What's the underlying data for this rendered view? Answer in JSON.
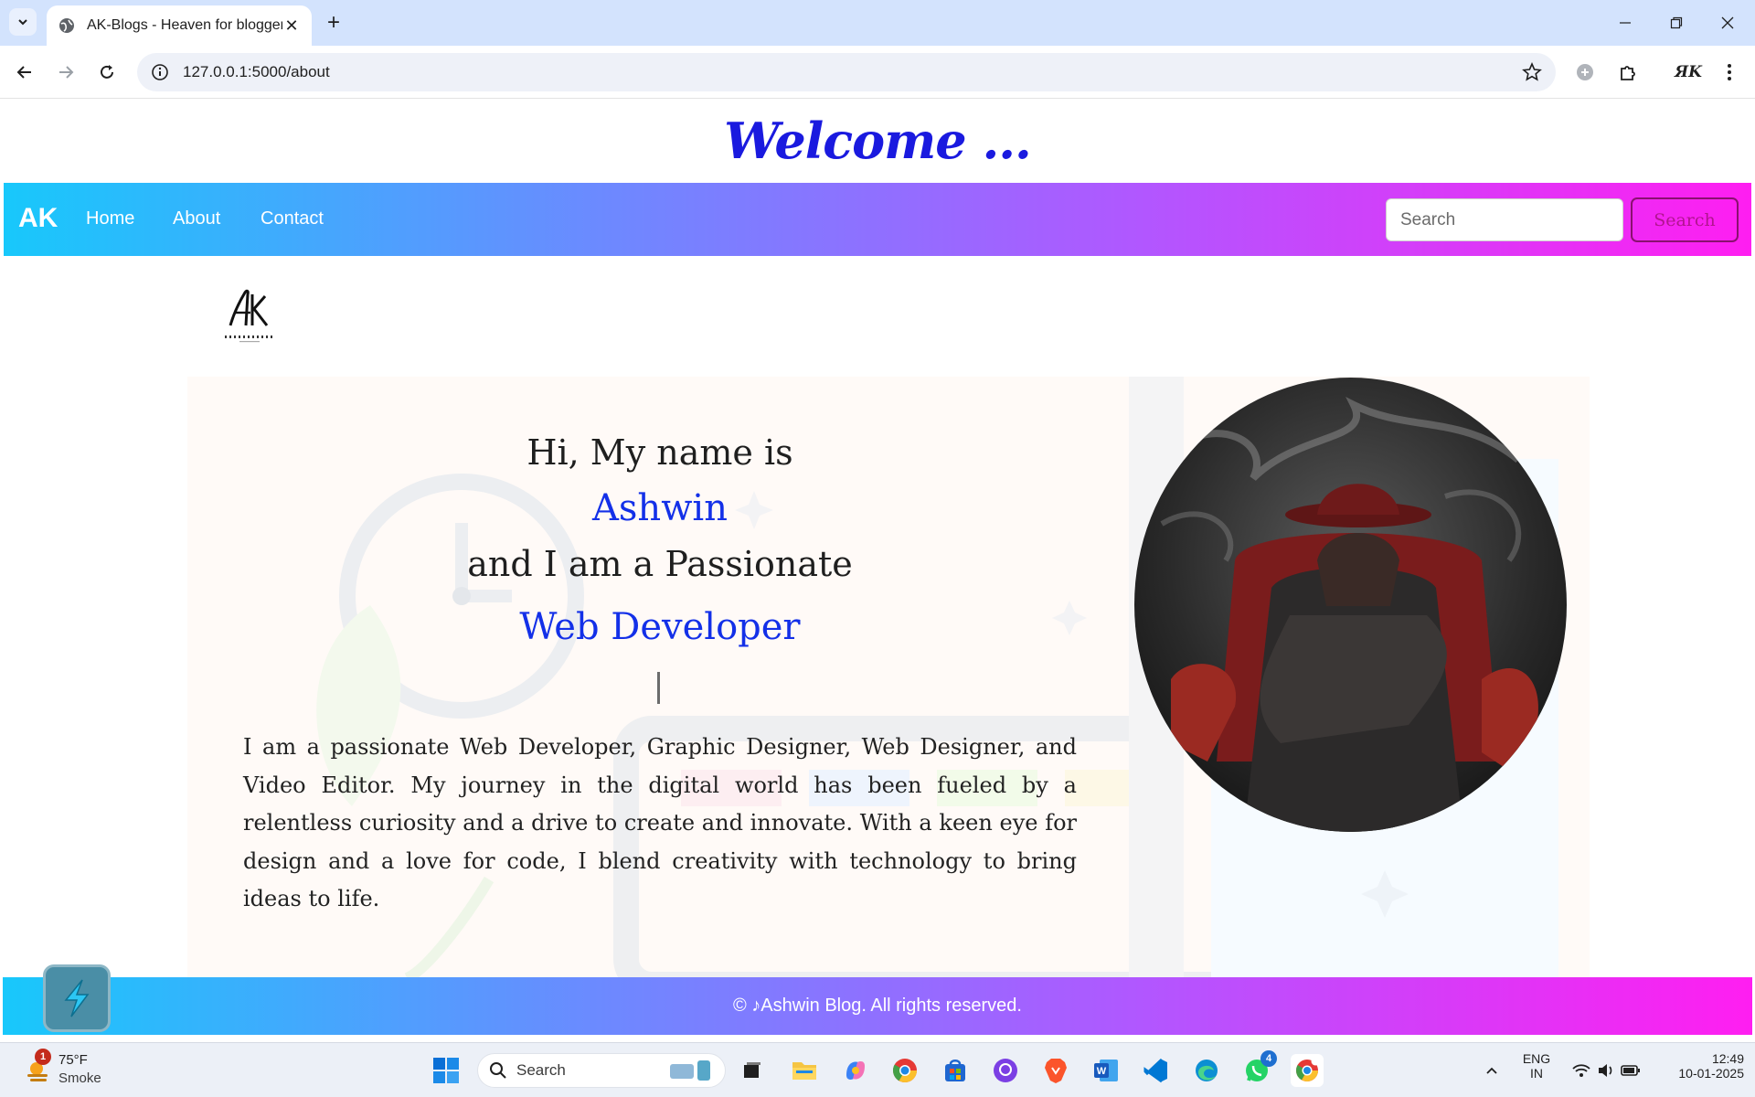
{
  "browser": {
    "tab_title": "AK-Blogs - Heaven for bloggers",
    "url": "127.0.0.1:5000/about"
  },
  "page": {
    "welcome": "Welcome ...",
    "nav": {
      "brand": "AK",
      "links": [
        "Home",
        "About",
        "Contact"
      ],
      "search_placeholder": "Search",
      "search_button": "Search"
    },
    "hero": {
      "intro_1": "Hi, My name is",
      "name": "Ashwin",
      "intro_2": "and I am a Passionate",
      "role": "Web Developer",
      "paragraph": "I am a passionate Web Developer, Graphic Designer, Web Designer, and Video Editor. My journey in the digital world has been fueled by a relentless curiosity and a drive to create and innovate. With a keen eye for design and a love for code, I blend creativity with technology to bring ideas to life."
    },
    "footer": "© ♪Ashwin Blog. All rights reserved."
  },
  "taskbar": {
    "weather_temp": "75°F",
    "weather_cond": "Smoke",
    "weather_badge": "1",
    "search_label": "Search",
    "whatsapp_badge": "4",
    "lang_1": "ENG",
    "lang_2": "IN",
    "time": "12:49",
    "date": "10-01-2025"
  },
  "colors": {
    "accent_blue": "#1330e8",
    "gradient_start": "#18c8fb",
    "gradient_end": "#ff1ef1"
  }
}
